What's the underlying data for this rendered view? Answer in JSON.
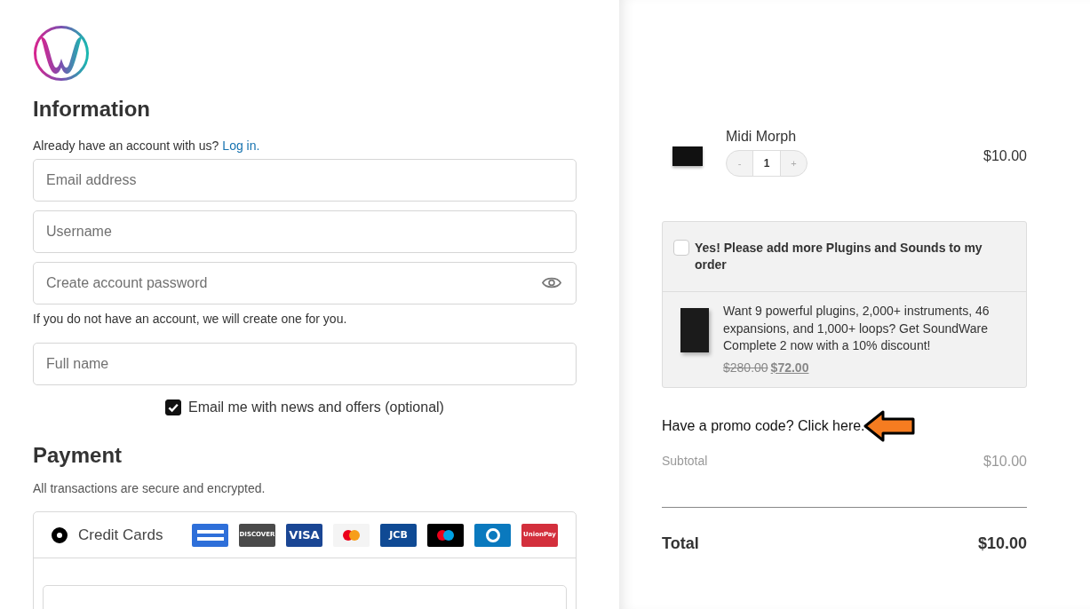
{
  "information": {
    "title": "Information",
    "account_prompt": "Already have an account with us?",
    "login_link": "Log in.",
    "fields": [
      {
        "placeholder": "Email address",
        "kind": "text"
      },
      {
        "placeholder": "Username",
        "kind": "text"
      },
      {
        "placeholder": "Create account password",
        "kind": "password"
      }
    ],
    "account_note": "If you do not have an account, we will create one for you.",
    "full_name": {
      "placeholder": "Full name"
    },
    "newsletter": {
      "label": "Email me with news and offers (optional)",
      "checked": true
    }
  },
  "payment": {
    "title": "Payment",
    "note": "All transactions are secure and encrypted.",
    "methods": [
      {
        "label": "Credit Cards",
        "selected": true,
        "cards": [
          {
            "kind": "amex"
          },
          {
            "kind": "discover",
            "label": "DISCOVER"
          },
          {
            "kind": "visa",
            "label": "VISA"
          },
          {
            "kind": "mastercard"
          },
          {
            "kind": "jcb",
            "label": "JCB"
          },
          {
            "kind": "maestro"
          },
          {
            "kind": "diners"
          },
          {
            "kind": "unionpay",
            "label": "UnionPay"
          }
        ]
      }
    ]
  },
  "cart": {
    "items": [
      {
        "name": "Midi Morph",
        "minus": "-",
        "quantity": "1",
        "plus": "+",
        "price": "$10.00"
      }
    ],
    "upsell": {
      "checked": false,
      "label": "Yes! Please add more Plugins and Sounds to my order",
      "description": "Want 9 powerful plugins, 2,000+ instruments, 46 expansions, and 1,000+ loops? Get SoundWare Complete 2 now with a 10% discount!",
      "old_price": "$280.00",
      "price": "$72.00"
    },
    "promo": "Have a promo code? Click here.",
    "subtotal": {
      "label": "Subtotal",
      "value": "$10.00"
    },
    "total": {
      "label": "Total",
      "value": "$10.00"
    }
  }
}
